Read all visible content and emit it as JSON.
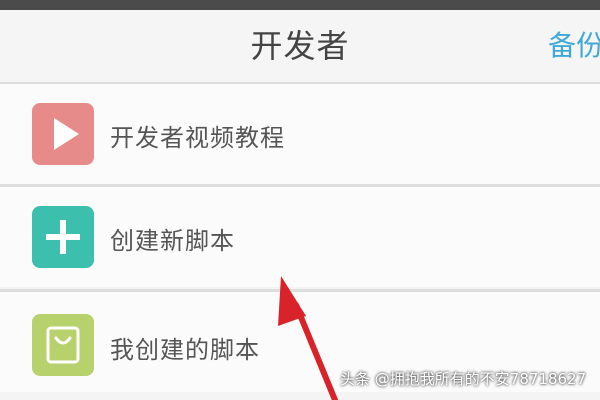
{
  "nav": {
    "title": "开发者",
    "action_label": "备份"
  },
  "menu": {
    "items": [
      {
        "label": "开发者视频教程",
        "icon": "play-icon",
        "icon_color": "#e78a8a"
      },
      {
        "label": "创建新脚本",
        "icon": "plus-icon",
        "icon_color": "#3dbfae"
      },
      {
        "label": "我创建的脚本",
        "icon": "bag-icon",
        "icon_color": "#b7d26d"
      }
    ]
  },
  "colors": {
    "accent": "#3fa9d8",
    "arrow": "#d8232a"
  },
  "watermark": {
    "text": "头条 @拥抱我所有的不安78718627"
  }
}
